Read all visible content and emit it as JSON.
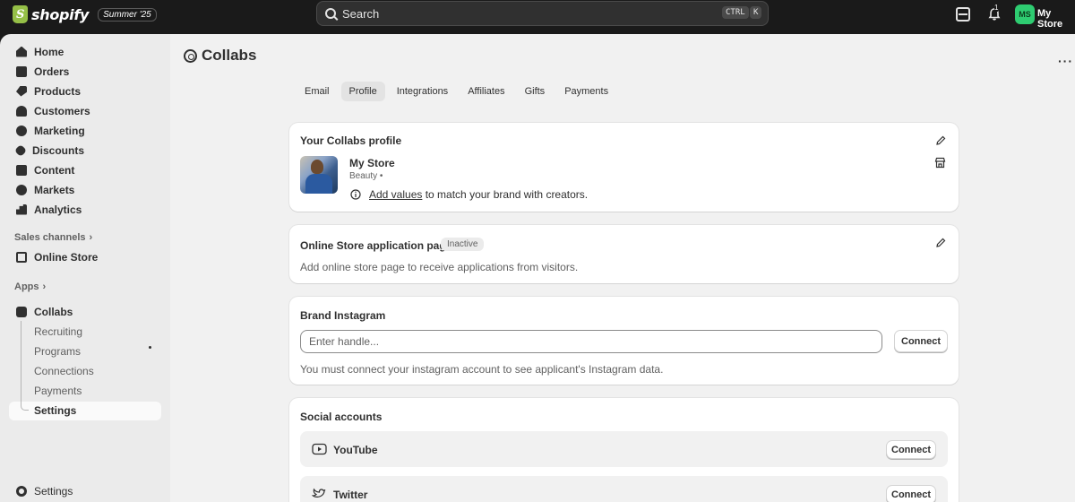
{
  "topbar": {
    "logo_text": "shopify",
    "edition": "Summer '25",
    "search_label": "Search",
    "kbd_ctrl": "CTRL",
    "kbd_k": "K",
    "notification_count": "1",
    "avatar_initials": "MS",
    "store_name": "My Store"
  },
  "sidebar": {
    "items": [
      {
        "label": "Home",
        "icon": "home-icon"
      },
      {
        "label": "Orders",
        "icon": "orders-icon"
      },
      {
        "label": "Products",
        "icon": "tag-icon"
      },
      {
        "label": "Customers",
        "icon": "person-icon"
      },
      {
        "label": "Marketing",
        "icon": "target-icon"
      },
      {
        "label": "Discounts",
        "icon": "discount-icon"
      },
      {
        "label": "Content",
        "icon": "content-icon"
      },
      {
        "label": "Markets",
        "icon": "globe-icon"
      },
      {
        "label": "Analytics",
        "icon": "chart-icon"
      }
    ],
    "sales_channels_label": "Sales channels",
    "online_store_label": "Online Store",
    "apps_label": "Apps",
    "collabs_label": "Collabs",
    "collabs_sub": [
      "Recruiting",
      "Programs",
      "Connections",
      "Payments",
      "Settings"
    ],
    "settings_label": "Settings"
  },
  "main": {
    "title": "Collabs",
    "tabs": [
      {
        "label": "Email",
        "active": false
      },
      {
        "label": "Profile",
        "active": true
      },
      {
        "label": "Integrations",
        "active": false
      },
      {
        "label": "Affiliates",
        "active": false
      },
      {
        "label": "Gifts",
        "active": false
      },
      {
        "label": "Payments",
        "active": false
      }
    ],
    "profile_card": {
      "title": "Your Collabs profile",
      "store_name": "My Store",
      "category": "Beauty •",
      "add_values_link": "Add values",
      "add_values_rest": " to match your brand with creators."
    },
    "online_store_card": {
      "title": "Online Store application page",
      "badge": "Inactive",
      "description": "Add online store page to receive applications from visitors."
    },
    "instagram_card": {
      "title": "Brand Instagram",
      "placeholder": "Enter handle...",
      "connect_label": "Connect",
      "description": "You must connect your instagram account to see applicant's Instagram data."
    },
    "social_card": {
      "title": "Social accounts",
      "accounts": [
        {
          "name": "YouTube",
          "connect_label": "Connect"
        },
        {
          "name": "Twitter",
          "connect_label": "Connect"
        }
      ]
    }
  },
  "colors": {
    "topbar_bg": "#1a1a1a",
    "sidebar_bg": "#ebebeb",
    "main_bg": "#f1f1f1",
    "avatar_bg": "#2ecc71",
    "logo_green": "#95bf47"
  }
}
